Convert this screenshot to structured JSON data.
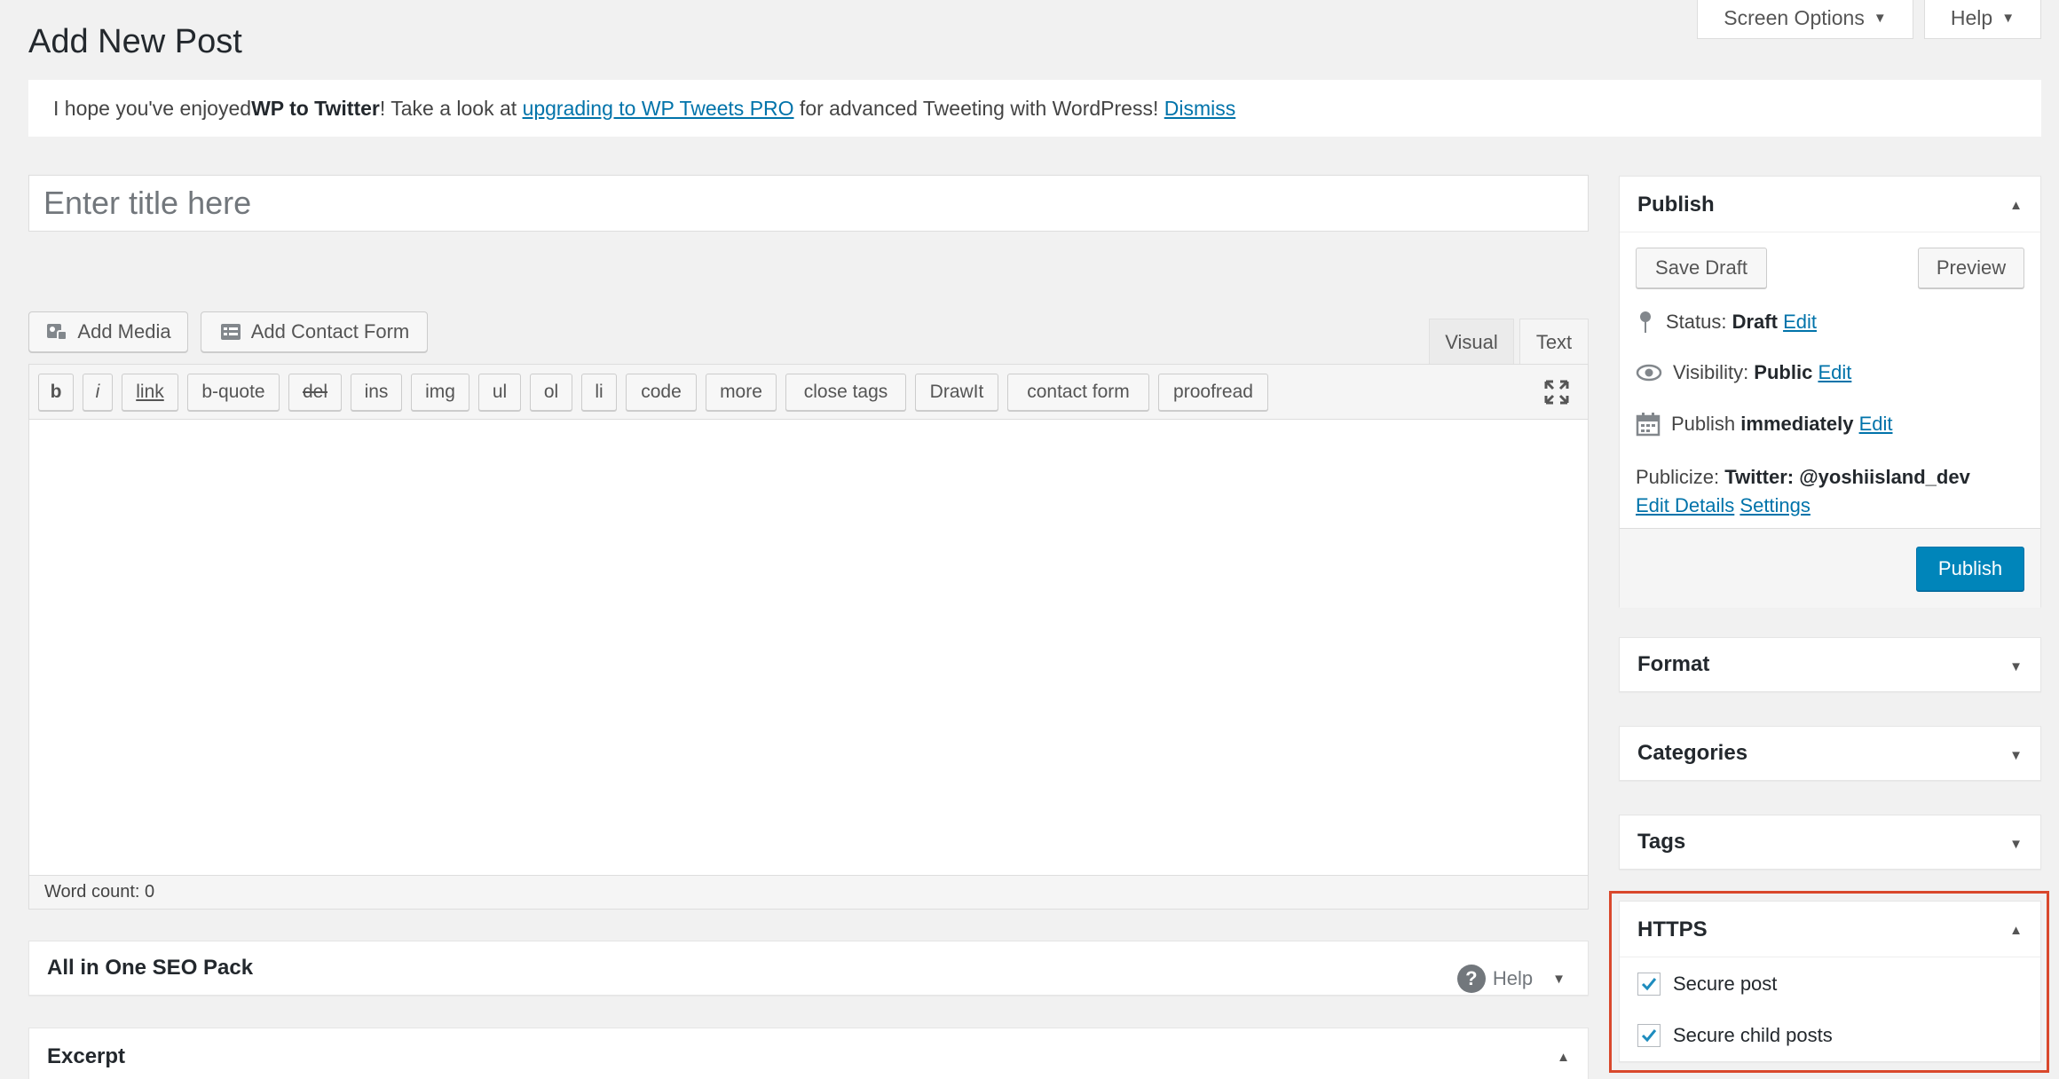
{
  "header": {
    "screen_options_label": "Screen Options",
    "help_label": "Help",
    "page_title": "Add New Post"
  },
  "notice": {
    "text_before": "I hope you've enjoyed ",
    "plugin_name": "WP to Twitter",
    "text_middle": "! Take a look at ",
    "upgrade_link": "upgrading to WP Tweets PRO",
    "text_after": " for advanced Tweeting with WordPress! ",
    "dismiss_link": "Dismiss"
  },
  "title_field": {
    "placeholder": "Enter title here"
  },
  "media_buttons": {
    "add_media": "Add Media",
    "add_contact_form": "Add Contact Form"
  },
  "editor_tabs": {
    "visual": "Visual",
    "text": "Text"
  },
  "quicktags": [
    "b",
    "i",
    "link",
    "b-quote",
    "del",
    "ins",
    "img",
    "ul",
    "ol",
    "li",
    "code",
    "more",
    "close tags",
    "DrawIt",
    "contact form",
    "proofread"
  ],
  "word_count": "Word count: 0",
  "main_boxes": {
    "seo_title": "All in One SEO Pack",
    "seo_help": "Help",
    "excerpt_title": "Excerpt"
  },
  "publish_box": {
    "title": "Publish",
    "save_draft": "Save Draft",
    "preview": "Preview",
    "status_label": "Status: ",
    "status_value": "Draft",
    "visibility_label": "Visibility: ",
    "visibility_value": "Public",
    "publish_label": "Publish ",
    "publish_value": "immediately",
    "edit": "Edit",
    "publicize_label": "Publicize: ",
    "publicize_value": "Twitter: @yoshiisland_dev",
    "edit_details": "Edit Details",
    "settings": "Settings",
    "publish_button": "Publish"
  },
  "sidebar_boxes": {
    "format": "Format",
    "categories": "Categories",
    "tags": "Tags"
  },
  "https_box": {
    "title": "HTTPS",
    "secure_post": "Secure post",
    "secure_child_posts": "Secure child posts",
    "secure_post_checked": true,
    "secure_child_checked": true
  },
  "colors": {
    "link": "#0073aa",
    "primary_button": "#0085ba",
    "highlight_border": "#d9482c"
  }
}
